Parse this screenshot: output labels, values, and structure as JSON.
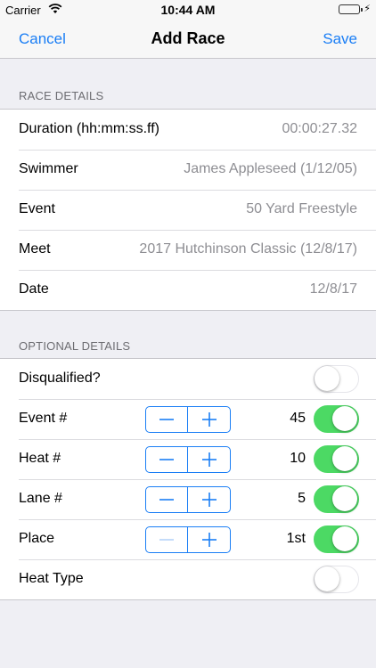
{
  "status_bar": {
    "carrier": "Carrier",
    "time": "10:44 AM",
    "charging_glyph": "⚡"
  },
  "nav": {
    "cancel_label": "Cancel",
    "title": "Add Race",
    "save_label": "Save"
  },
  "race_details": {
    "header": "RACE DETAILS",
    "rows": [
      {
        "label": "Duration (hh:mm:ss.ff)",
        "value": "00:00:27.32"
      },
      {
        "label": "Swimmer",
        "value": "James Appleseed (1/12/05)"
      },
      {
        "label": "Event",
        "value": "50 Yard Freestyle"
      },
      {
        "label": "Meet",
        "value": "2017 Hutchinson Classic (12/8/17)"
      },
      {
        "label": "Date",
        "value": "12/8/17"
      }
    ]
  },
  "optional_details": {
    "header": "OPTIONAL DETAILS",
    "disqualified": {
      "label": "Disqualified?",
      "on": false
    },
    "event_num": {
      "label": "Event #",
      "value": "45",
      "on": true
    },
    "heat_num": {
      "label": "Heat #",
      "value": "10",
      "on": true
    },
    "lane_num": {
      "label": "Lane #",
      "value": "5",
      "on": true
    },
    "place": {
      "label": "Place",
      "value": "1st",
      "on": true,
      "minus_disabled": true
    },
    "heat_type": {
      "label": "Heat Type",
      "on": false
    }
  },
  "colors": {
    "accent": "#1a7ef5",
    "switch_on": "#4cd964",
    "background": "#efeff4"
  }
}
